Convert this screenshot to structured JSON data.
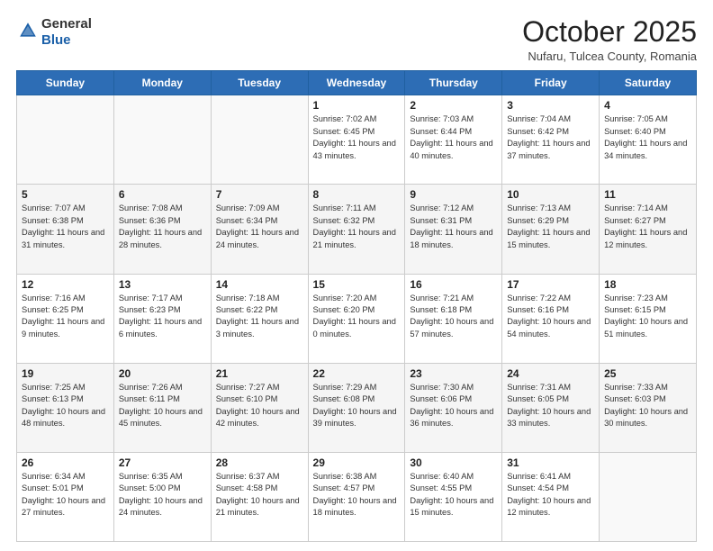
{
  "header": {
    "logo_general": "General",
    "logo_blue": "Blue",
    "month": "October 2025",
    "location": "Nufaru, Tulcea County, Romania"
  },
  "days_of_week": [
    "Sunday",
    "Monday",
    "Tuesday",
    "Wednesday",
    "Thursday",
    "Friday",
    "Saturday"
  ],
  "weeks": [
    [
      {
        "day": "",
        "info": ""
      },
      {
        "day": "",
        "info": ""
      },
      {
        "day": "",
        "info": ""
      },
      {
        "day": "1",
        "info": "Sunrise: 7:02 AM\nSunset: 6:45 PM\nDaylight: 11 hours and 43 minutes."
      },
      {
        "day": "2",
        "info": "Sunrise: 7:03 AM\nSunset: 6:44 PM\nDaylight: 11 hours and 40 minutes."
      },
      {
        "day": "3",
        "info": "Sunrise: 7:04 AM\nSunset: 6:42 PM\nDaylight: 11 hours and 37 minutes."
      },
      {
        "day": "4",
        "info": "Sunrise: 7:05 AM\nSunset: 6:40 PM\nDaylight: 11 hours and 34 minutes."
      }
    ],
    [
      {
        "day": "5",
        "info": "Sunrise: 7:07 AM\nSunset: 6:38 PM\nDaylight: 11 hours and 31 minutes."
      },
      {
        "day": "6",
        "info": "Sunrise: 7:08 AM\nSunset: 6:36 PM\nDaylight: 11 hours and 28 minutes."
      },
      {
        "day": "7",
        "info": "Sunrise: 7:09 AM\nSunset: 6:34 PM\nDaylight: 11 hours and 24 minutes."
      },
      {
        "day": "8",
        "info": "Sunrise: 7:11 AM\nSunset: 6:32 PM\nDaylight: 11 hours and 21 minutes."
      },
      {
        "day": "9",
        "info": "Sunrise: 7:12 AM\nSunset: 6:31 PM\nDaylight: 11 hours and 18 minutes."
      },
      {
        "day": "10",
        "info": "Sunrise: 7:13 AM\nSunset: 6:29 PM\nDaylight: 11 hours and 15 minutes."
      },
      {
        "day": "11",
        "info": "Sunrise: 7:14 AM\nSunset: 6:27 PM\nDaylight: 11 hours and 12 minutes."
      }
    ],
    [
      {
        "day": "12",
        "info": "Sunrise: 7:16 AM\nSunset: 6:25 PM\nDaylight: 11 hours and 9 minutes."
      },
      {
        "day": "13",
        "info": "Sunrise: 7:17 AM\nSunset: 6:23 PM\nDaylight: 11 hours and 6 minutes."
      },
      {
        "day": "14",
        "info": "Sunrise: 7:18 AM\nSunset: 6:22 PM\nDaylight: 11 hours and 3 minutes."
      },
      {
        "day": "15",
        "info": "Sunrise: 7:20 AM\nSunset: 6:20 PM\nDaylight: 11 hours and 0 minutes."
      },
      {
        "day": "16",
        "info": "Sunrise: 7:21 AM\nSunset: 6:18 PM\nDaylight: 10 hours and 57 minutes."
      },
      {
        "day": "17",
        "info": "Sunrise: 7:22 AM\nSunset: 6:16 PM\nDaylight: 10 hours and 54 minutes."
      },
      {
        "day": "18",
        "info": "Sunrise: 7:23 AM\nSunset: 6:15 PM\nDaylight: 10 hours and 51 minutes."
      }
    ],
    [
      {
        "day": "19",
        "info": "Sunrise: 7:25 AM\nSunset: 6:13 PM\nDaylight: 10 hours and 48 minutes."
      },
      {
        "day": "20",
        "info": "Sunrise: 7:26 AM\nSunset: 6:11 PM\nDaylight: 10 hours and 45 minutes."
      },
      {
        "day": "21",
        "info": "Sunrise: 7:27 AM\nSunset: 6:10 PM\nDaylight: 10 hours and 42 minutes."
      },
      {
        "day": "22",
        "info": "Sunrise: 7:29 AM\nSunset: 6:08 PM\nDaylight: 10 hours and 39 minutes."
      },
      {
        "day": "23",
        "info": "Sunrise: 7:30 AM\nSunset: 6:06 PM\nDaylight: 10 hours and 36 minutes."
      },
      {
        "day": "24",
        "info": "Sunrise: 7:31 AM\nSunset: 6:05 PM\nDaylight: 10 hours and 33 minutes."
      },
      {
        "day": "25",
        "info": "Sunrise: 7:33 AM\nSunset: 6:03 PM\nDaylight: 10 hours and 30 minutes."
      }
    ],
    [
      {
        "day": "26",
        "info": "Sunrise: 6:34 AM\nSunset: 5:01 PM\nDaylight: 10 hours and 27 minutes."
      },
      {
        "day": "27",
        "info": "Sunrise: 6:35 AM\nSunset: 5:00 PM\nDaylight: 10 hours and 24 minutes."
      },
      {
        "day": "28",
        "info": "Sunrise: 6:37 AM\nSunset: 4:58 PM\nDaylight: 10 hours and 21 minutes."
      },
      {
        "day": "29",
        "info": "Sunrise: 6:38 AM\nSunset: 4:57 PM\nDaylight: 10 hours and 18 minutes."
      },
      {
        "day": "30",
        "info": "Sunrise: 6:40 AM\nSunset: 4:55 PM\nDaylight: 10 hours and 15 minutes."
      },
      {
        "day": "31",
        "info": "Sunrise: 6:41 AM\nSunset: 4:54 PM\nDaylight: 10 hours and 12 minutes."
      },
      {
        "day": "",
        "info": ""
      }
    ]
  ]
}
